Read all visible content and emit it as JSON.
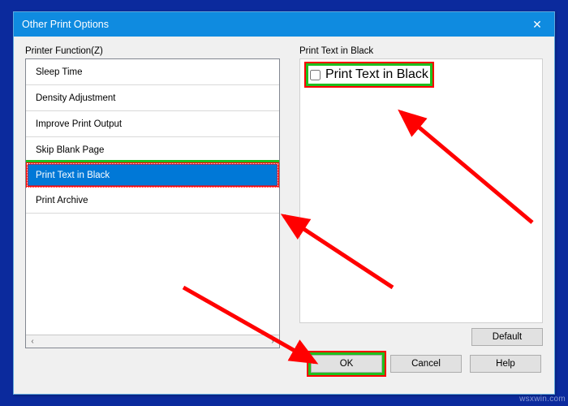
{
  "window": {
    "title": "Other Print Options"
  },
  "left": {
    "label": "Printer Function(Z)",
    "items": [
      "Sleep Time",
      "Density Adjustment",
      "Improve Print Output",
      "Skip Blank Page",
      "Print Text in Black",
      "Print Archive"
    ],
    "selected_index": 4
  },
  "right": {
    "group_label": "Print Text in Black",
    "checkbox_label": "Print Text in Black",
    "checkbox_checked": false,
    "default_button": "Default"
  },
  "buttons": {
    "ok": "OK",
    "cancel": "Cancel",
    "help": "Help"
  },
  "watermark": "wsxwin.com",
  "annotations": {
    "highlight_color_primary": "#1fbf1f",
    "highlight_color_secondary": "#ff0000",
    "arrows_from_bottom_left": true
  }
}
